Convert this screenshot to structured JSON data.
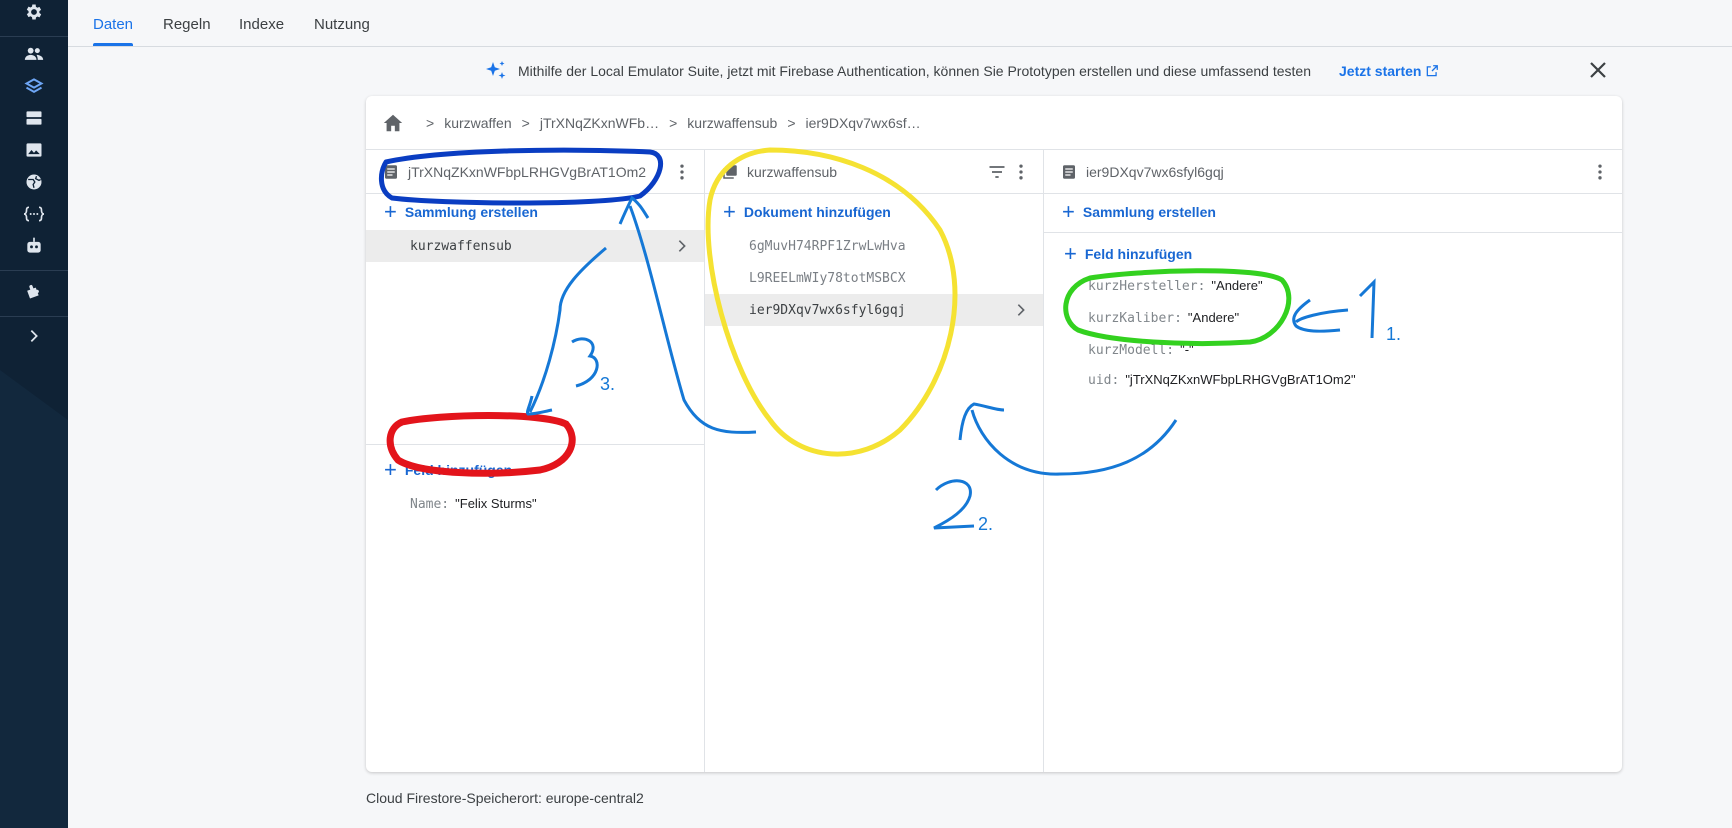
{
  "tabs": [
    {
      "label": "Daten",
      "active": true
    },
    {
      "label": "Regeln",
      "active": false
    },
    {
      "label": "Indexe",
      "active": false
    },
    {
      "label": "Nutzung",
      "active": false
    }
  ],
  "banner": {
    "message": "Mithilfe der Local Emulator Suite, jetzt mit Firebase Authentication, können Sie Prototypen erstellen und diese umfassend testen",
    "link_label": "Jetzt starten"
  },
  "breadcrumb": [
    "kurzwaffen",
    "jTrXNqZKxnWFb…",
    "kurzwaffensub",
    "ier9DXqv7wx6sf…"
  ],
  "column1": {
    "title": "jTrXNqZKxnWFbpLRHGVgBrAT1Om2",
    "add_collection_label": "Sammlung erstellen",
    "collections": [
      "kurzwaffensub"
    ],
    "add_field_label": "Feld hinzufügen",
    "fields": [
      {
        "key": "Name:",
        "value": "\"Felix Sturms\""
      }
    ]
  },
  "column2": {
    "title": "kurzwaffensub",
    "add_document_label": "Dokument hinzufügen",
    "documents": [
      "6gMuvH74RPF1ZrwLwHva",
      "L9REELmWIy78totMSBCX",
      "ier9DXqv7wx6sfyl6gqj"
    ]
  },
  "column3": {
    "title": "ier9DXqv7wx6sfyl6gqj",
    "add_collection_label": "Sammlung erstellen",
    "add_field_label": "Feld hinzufügen",
    "fields": [
      {
        "key": "kurzHersteller:",
        "value": "\"Andere\""
      },
      {
        "key": "kurzKaliber:",
        "value": "\"Andere\""
      },
      {
        "key": "kurzModell:",
        "value": "\"-\""
      },
      {
        "key": "uid:",
        "value": "\"jTrXNqZKxnWFbpLRHGVgBrAT1Om2\""
      }
    ]
  },
  "footer": {
    "text": "Cloud Firestore-Speicherort: europe-central2"
  },
  "annotations": {
    "labels": [
      "1.",
      "2.",
      "3."
    ]
  },
  "colors": {
    "accent": "#1a73e8",
    "rail": "#0f2235",
    "yellow": "#f5e232",
    "green": "#33d11f",
    "red": "#e3141b",
    "blue_marker": "#0a3dc2",
    "blue_pen": "#1578d6"
  },
  "icons": [
    "settings-icon",
    "users-icon",
    "firestore-icon",
    "database-icon",
    "storage-icon",
    "hosting-icon",
    "functions-icon",
    "ml-icon",
    "extensions-icon",
    "expand-icon",
    "sparkle-icon",
    "external-link-icon",
    "close-icon",
    "home-icon",
    "document-icon",
    "collection-icon",
    "filter-icon",
    "more-vert-icon",
    "chevron-right-icon"
  ]
}
